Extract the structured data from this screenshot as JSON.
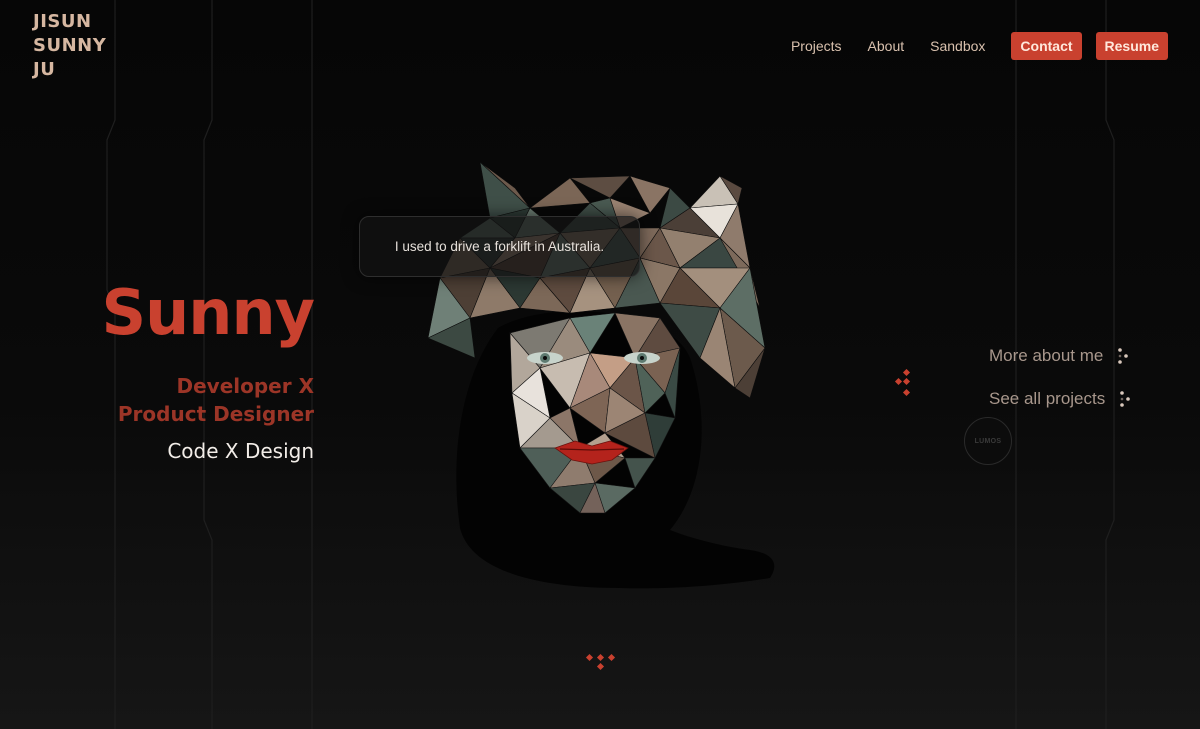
{
  "brand": {
    "line1": "JISUN",
    "line2": "SUNNY",
    "line3": "JU"
  },
  "nav": {
    "projects": "Projects",
    "about": "About",
    "sandbox": "Sandbox",
    "contact": "Contact",
    "resume": "Resume"
  },
  "bubble": {
    "text": "I used to drive a forklift in Australia."
  },
  "hero": {
    "name": "Sunny",
    "role_line1": "Developer X",
    "role_line2": "Product Designer",
    "tagline": "Code X Design"
  },
  "side_links": {
    "about": "More about me",
    "projects": "See all projects"
  },
  "badge": {
    "text": "LUMOS"
  },
  "colors": {
    "accent": "#c9412f",
    "accent_dark": "#9c3527",
    "brand_text": "#d6b7a1",
    "background": "#080808"
  },
  "icons": {
    "side_link_icon": "dots-icon",
    "scroll_icon": "diamond-cluster-icon"
  }
}
